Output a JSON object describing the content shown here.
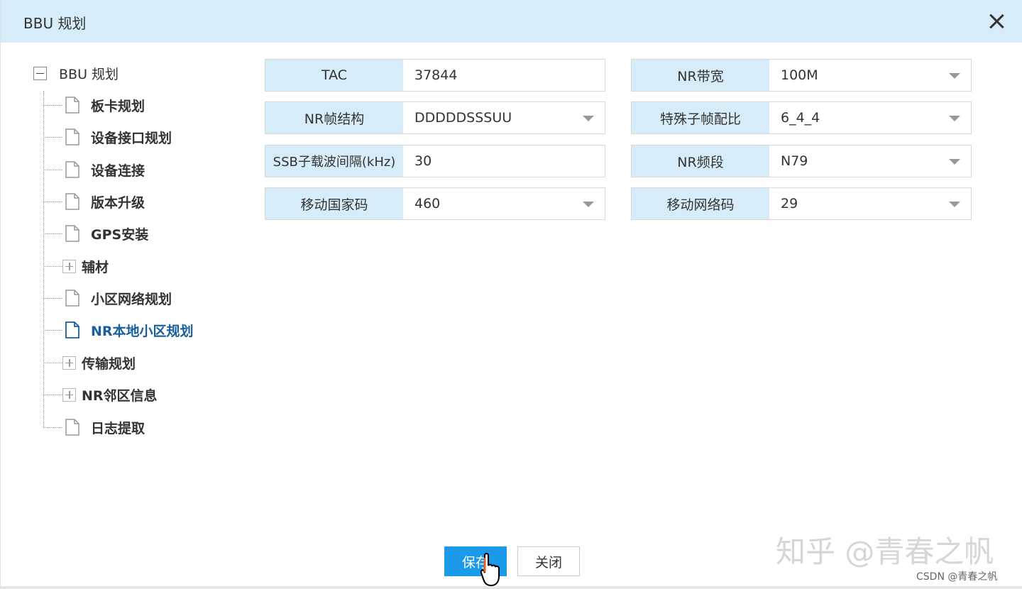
{
  "dialog": {
    "title": "BBU 规划",
    "close_icon": "close-icon"
  },
  "tree": {
    "root": {
      "label": "BBU 规划",
      "icon": "minus-box-icon"
    },
    "items": [
      {
        "label": "板卡规划",
        "type": "doc"
      },
      {
        "label": "设备接口规划",
        "type": "doc"
      },
      {
        "label": "设备连接",
        "type": "doc"
      },
      {
        "label": "版本升级",
        "type": "doc"
      },
      {
        "label": "GPS安装",
        "type": "doc"
      },
      {
        "label": "辅材",
        "type": "folder"
      },
      {
        "label": "小区网络规划",
        "type": "doc"
      },
      {
        "label": "NR本地小区规划",
        "type": "doc",
        "active": true
      },
      {
        "label": "传输规划",
        "type": "folder"
      },
      {
        "label": "NR邻区信息",
        "type": "folder"
      },
      {
        "label": "日志提取",
        "type": "doc"
      }
    ]
  },
  "form": {
    "fields": [
      {
        "label": "TAC",
        "value": "37844",
        "dropdown": false
      },
      {
        "label": "NR带宽",
        "value": "100M",
        "dropdown": true
      },
      {
        "label": "NR帧结构",
        "value": "DDDDDSSSUU",
        "dropdown": true
      },
      {
        "label": "特殊子帧配比",
        "value": "6_4_4",
        "dropdown": true
      },
      {
        "label": "SSB子载波间隔(kHz)",
        "value": "30",
        "dropdown": false
      },
      {
        "label": "NR频段",
        "value": "N79",
        "dropdown": true
      },
      {
        "label": "移动国家码",
        "value": "460",
        "dropdown": true
      },
      {
        "label": "移动网络码",
        "value": "29",
        "dropdown": true
      }
    ]
  },
  "buttons": {
    "save": "保存",
    "close": "关闭"
  },
  "watermark": {
    "zhihu": "知乎 @青春之帆",
    "csdn": "CSDN @青春之帆"
  },
  "colors": {
    "header_bg": "#d6ecf8",
    "label_bg": "#d6ecf8",
    "primary": "#1a9ae8",
    "active_tree": "#1a5e9c"
  }
}
